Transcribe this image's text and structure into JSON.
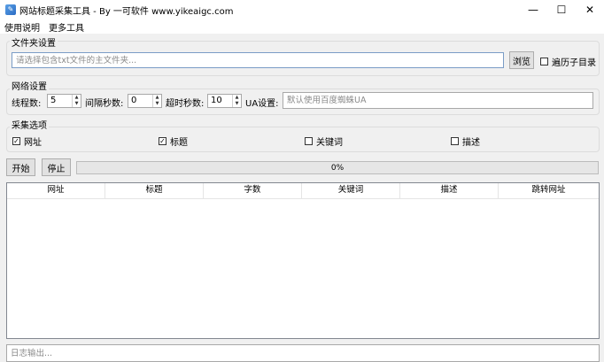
{
  "window": {
    "title": "网站标题采集工具 - By 一可软件 www.yikeaigc.com",
    "minimize": "—",
    "maximize": "☐",
    "close": "✕"
  },
  "menu": [
    {
      "label": "使用说明"
    },
    {
      "label": "更多工具"
    }
  ],
  "folder_group": {
    "title": "文件夹设置",
    "path_placeholder": "请选择包含txt文件的主文件夹...",
    "path_value": "",
    "browse_label": "浏览",
    "recursive_label": "遍历子目录",
    "recursive_checked": false
  },
  "network_group": {
    "title": "网络设置",
    "threads_label": "线程数:",
    "threads_value": "5",
    "interval_label": "间隔秒数:",
    "interval_value": "0",
    "timeout_label": "超时秒数:",
    "timeout_value": "10",
    "ua_label": "UA设置:",
    "ua_placeholder": "默认使用百度蜘蛛UA",
    "ua_value": ""
  },
  "collect_group": {
    "title": "采集选项",
    "options": [
      {
        "label": "网址",
        "checked": true
      },
      {
        "label": "标题",
        "checked": true
      },
      {
        "label": "关键词",
        "checked": false
      },
      {
        "label": "描述",
        "checked": false
      }
    ]
  },
  "controls": {
    "start_label": "开始",
    "stop_label": "停止",
    "progress_text": "0%",
    "progress_fraction": 0
  },
  "table": {
    "columns": [
      "网址",
      "标题",
      "字数",
      "关键词",
      "描述",
      "跳转网址"
    ],
    "rows": []
  },
  "log": {
    "placeholder": "日志输出..."
  },
  "colors": {
    "progress_fill": "#06b025"
  },
  "icons": {
    "check": "✓",
    "spin_up": "▲",
    "spin_down": "▼"
  }
}
